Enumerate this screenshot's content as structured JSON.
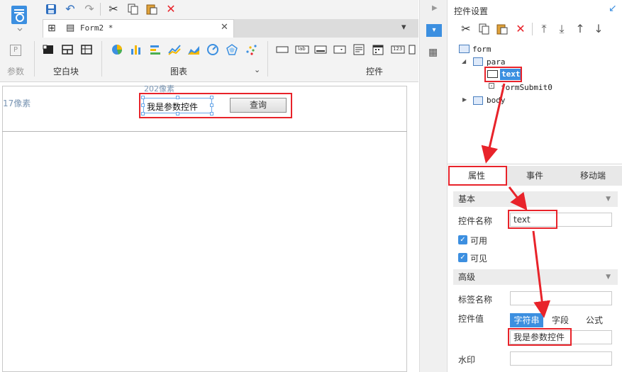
{
  "toolbar": {
    "file_tab_label": "Form2 *",
    "group_param_label": "参数",
    "group_blank_label": "空白块",
    "group_chart_label": "图表",
    "group_widget_label": "控件",
    "widget_lab_label": "lab",
    "widget_123_label": "123"
  },
  "canvas": {
    "ruler_left": "17像素",
    "ruler_top": "202像素",
    "text_widget_value": "我是参数控件",
    "query_button_label": "查询"
  },
  "panel": {
    "title": "控件设置",
    "tree": [
      {
        "label": "form"
      },
      {
        "label": "para"
      },
      {
        "label": "text"
      },
      {
        "label": "formSubmit0"
      },
      {
        "label": "body"
      }
    ],
    "tabs": [
      "属性",
      "事件",
      "移动端"
    ],
    "sections": {
      "basic": "基本",
      "advanced": "高级"
    },
    "props": {
      "name_label": "控件名称",
      "name_value": "text",
      "enabled_label": "可用",
      "visible_label": "可见",
      "tag_label": "标签名称",
      "tag_value": "",
      "value_label": "控件值",
      "value_types": [
        "字符串",
        "字段",
        "公式"
      ],
      "value_value": "我是参数控件",
      "watermark_label": "水印",
      "watermark_value": ""
    }
  },
  "colors": {
    "accent": "#3c8fe0",
    "highlight": "#e8232a"
  }
}
